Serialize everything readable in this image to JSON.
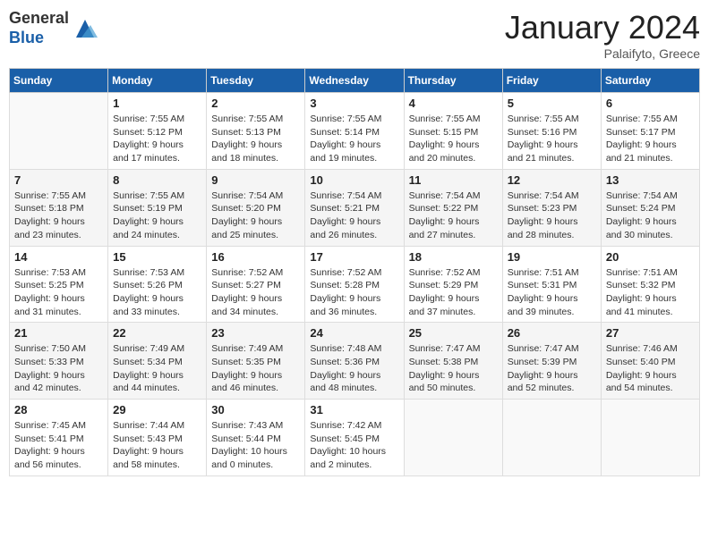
{
  "header": {
    "logo_general": "General",
    "logo_blue": "Blue",
    "month_title": "January 2024",
    "location": "Palaifyto, Greece"
  },
  "weekdays": [
    "Sunday",
    "Monday",
    "Tuesday",
    "Wednesday",
    "Thursday",
    "Friday",
    "Saturday"
  ],
  "weeks": [
    [
      {
        "day": "",
        "info": ""
      },
      {
        "day": "1",
        "info": "Sunrise: 7:55 AM\nSunset: 5:12 PM\nDaylight: 9 hours\nand 17 minutes."
      },
      {
        "day": "2",
        "info": "Sunrise: 7:55 AM\nSunset: 5:13 PM\nDaylight: 9 hours\nand 18 minutes."
      },
      {
        "day": "3",
        "info": "Sunrise: 7:55 AM\nSunset: 5:14 PM\nDaylight: 9 hours\nand 19 minutes."
      },
      {
        "day": "4",
        "info": "Sunrise: 7:55 AM\nSunset: 5:15 PM\nDaylight: 9 hours\nand 20 minutes."
      },
      {
        "day": "5",
        "info": "Sunrise: 7:55 AM\nSunset: 5:16 PM\nDaylight: 9 hours\nand 21 minutes."
      },
      {
        "day": "6",
        "info": "Sunrise: 7:55 AM\nSunset: 5:17 PM\nDaylight: 9 hours\nand 21 minutes."
      }
    ],
    [
      {
        "day": "7",
        "info": "Sunrise: 7:55 AM\nSunset: 5:18 PM\nDaylight: 9 hours\nand 23 minutes."
      },
      {
        "day": "8",
        "info": "Sunrise: 7:55 AM\nSunset: 5:19 PM\nDaylight: 9 hours\nand 24 minutes."
      },
      {
        "day": "9",
        "info": "Sunrise: 7:54 AM\nSunset: 5:20 PM\nDaylight: 9 hours\nand 25 minutes."
      },
      {
        "day": "10",
        "info": "Sunrise: 7:54 AM\nSunset: 5:21 PM\nDaylight: 9 hours\nand 26 minutes."
      },
      {
        "day": "11",
        "info": "Sunrise: 7:54 AM\nSunset: 5:22 PM\nDaylight: 9 hours\nand 27 minutes."
      },
      {
        "day": "12",
        "info": "Sunrise: 7:54 AM\nSunset: 5:23 PM\nDaylight: 9 hours\nand 28 minutes."
      },
      {
        "day": "13",
        "info": "Sunrise: 7:54 AM\nSunset: 5:24 PM\nDaylight: 9 hours\nand 30 minutes."
      }
    ],
    [
      {
        "day": "14",
        "info": "Sunrise: 7:53 AM\nSunset: 5:25 PM\nDaylight: 9 hours\nand 31 minutes."
      },
      {
        "day": "15",
        "info": "Sunrise: 7:53 AM\nSunset: 5:26 PM\nDaylight: 9 hours\nand 33 minutes."
      },
      {
        "day": "16",
        "info": "Sunrise: 7:52 AM\nSunset: 5:27 PM\nDaylight: 9 hours\nand 34 minutes."
      },
      {
        "day": "17",
        "info": "Sunrise: 7:52 AM\nSunset: 5:28 PM\nDaylight: 9 hours\nand 36 minutes."
      },
      {
        "day": "18",
        "info": "Sunrise: 7:52 AM\nSunset: 5:29 PM\nDaylight: 9 hours\nand 37 minutes."
      },
      {
        "day": "19",
        "info": "Sunrise: 7:51 AM\nSunset: 5:31 PM\nDaylight: 9 hours\nand 39 minutes."
      },
      {
        "day": "20",
        "info": "Sunrise: 7:51 AM\nSunset: 5:32 PM\nDaylight: 9 hours\nand 41 minutes."
      }
    ],
    [
      {
        "day": "21",
        "info": "Sunrise: 7:50 AM\nSunset: 5:33 PM\nDaylight: 9 hours\nand 42 minutes."
      },
      {
        "day": "22",
        "info": "Sunrise: 7:49 AM\nSunset: 5:34 PM\nDaylight: 9 hours\nand 44 minutes."
      },
      {
        "day": "23",
        "info": "Sunrise: 7:49 AM\nSunset: 5:35 PM\nDaylight: 9 hours\nand 46 minutes."
      },
      {
        "day": "24",
        "info": "Sunrise: 7:48 AM\nSunset: 5:36 PM\nDaylight: 9 hours\nand 48 minutes."
      },
      {
        "day": "25",
        "info": "Sunrise: 7:47 AM\nSunset: 5:38 PM\nDaylight: 9 hours\nand 50 minutes."
      },
      {
        "day": "26",
        "info": "Sunrise: 7:47 AM\nSunset: 5:39 PM\nDaylight: 9 hours\nand 52 minutes."
      },
      {
        "day": "27",
        "info": "Sunrise: 7:46 AM\nSunset: 5:40 PM\nDaylight: 9 hours\nand 54 minutes."
      }
    ],
    [
      {
        "day": "28",
        "info": "Sunrise: 7:45 AM\nSunset: 5:41 PM\nDaylight: 9 hours\nand 56 minutes."
      },
      {
        "day": "29",
        "info": "Sunrise: 7:44 AM\nSunset: 5:43 PM\nDaylight: 9 hours\nand 58 minutes."
      },
      {
        "day": "30",
        "info": "Sunrise: 7:43 AM\nSunset: 5:44 PM\nDaylight: 10 hours\nand 0 minutes."
      },
      {
        "day": "31",
        "info": "Sunrise: 7:42 AM\nSunset: 5:45 PM\nDaylight: 10 hours\nand 2 minutes."
      },
      {
        "day": "",
        "info": ""
      },
      {
        "day": "",
        "info": ""
      },
      {
        "day": "",
        "info": ""
      }
    ]
  ]
}
